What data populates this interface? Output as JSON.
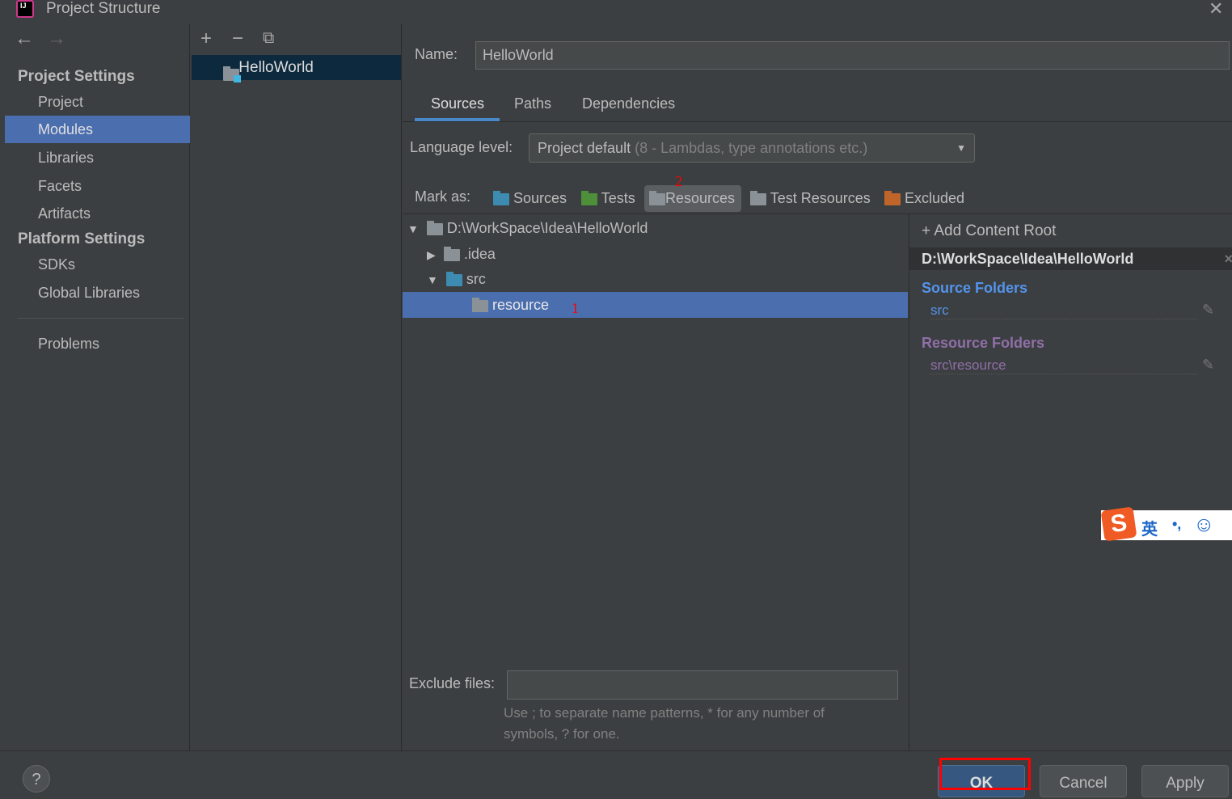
{
  "window": {
    "title": "Project Structure"
  },
  "sidebar": {
    "project_settings": "Project Settings",
    "items": [
      {
        "label": "Project"
      },
      {
        "label": "Modules",
        "selected": true
      },
      {
        "label": "Libraries"
      },
      {
        "label": "Facets"
      },
      {
        "label": "Artifacts"
      }
    ],
    "platform_settings": "Platform Settings",
    "platform_items": [
      {
        "label": "SDKs"
      },
      {
        "label": "Global Libraries"
      }
    ],
    "problems": "Problems"
  },
  "modules": {
    "items": [
      {
        "label": "HelloWorld",
        "selected": true
      }
    ]
  },
  "main": {
    "name_label": "Name:",
    "name_value": "HelloWorld",
    "tabs": [
      {
        "label": "Sources",
        "active": true
      },
      {
        "label": "Paths"
      },
      {
        "label": "Dependencies"
      }
    ],
    "language_label": "Language level:",
    "language_value": "Project default",
    "language_hint": "(8 - Lambdas, type annotations etc.)",
    "mark_as_label": "Mark as:",
    "mark_buttons": [
      {
        "label": "Sources",
        "color": "#3d8bb0"
      },
      {
        "label": "Tests",
        "color": "#4e8f3a"
      },
      {
        "label": "Resources",
        "color": "#8a9298"
      },
      {
        "label": "Test Resources",
        "color": "#8a9298"
      },
      {
        "label": "Excluded",
        "color": "#c0652a"
      }
    ],
    "annotation_1": "1",
    "annotation_2": "2",
    "tree": [
      {
        "label": "D:\\WorkSpace\\Idea\\HelloWorld",
        "expanded": true
      },
      {
        "label": ".idea",
        "expanded": false
      },
      {
        "label": "src",
        "expanded": true
      },
      {
        "label": "resource",
        "selected": true
      }
    ],
    "exclude_label": "Exclude files:",
    "exclude_value": "",
    "exclude_hint_1": "Use ; to separate name patterns, * for any number of",
    "exclude_hint_2": "symbols, ? for one."
  },
  "content_root": {
    "add_label": "Add Content Root",
    "path": "D:\\WorkSpace\\Idea\\HelloWorld",
    "source_title": "Source Folders",
    "source_items": [
      "src"
    ],
    "resource_title": "Resource Folders",
    "resource_items": [
      "src\\resource"
    ],
    "source_color": "#5394ec",
    "resource_color": "#8f6fa8"
  },
  "ime": {
    "lang": "英",
    "punct": "•,"
  },
  "footer": {
    "ok": "OK",
    "cancel": "Cancel",
    "apply": "Apply",
    "help": "?"
  }
}
